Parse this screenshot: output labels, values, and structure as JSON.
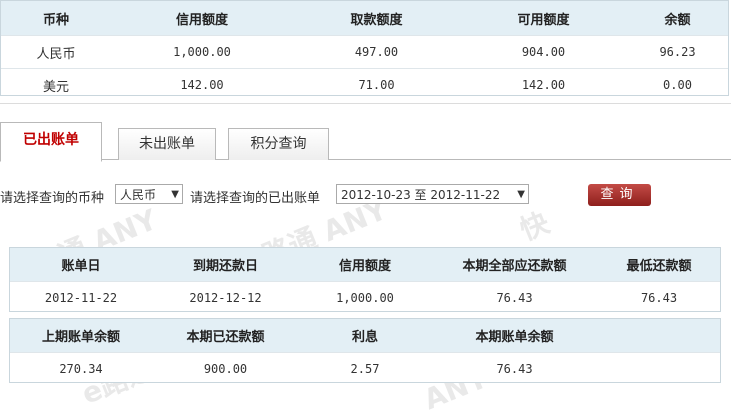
{
  "balances": {
    "headers": [
      "币种",
      "信用额度",
      "取款额度",
      "可用额度",
      "余额"
    ],
    "rows": [
      [
        "人民币",
        "1,000.00",
        "497.00",
        "904.00",
        "96.23"
      ],
      [
        "美元",
        "142.00",
        "71.00",
        "142.00",
        "0.00"
      ]
    ]
  },
  "tabs": [
    "已出账单",
    "未出账单",
    "积分查询"
  ],
  "filter": {
    "currency_label": "请选择查询的币种",
    "currency_value": "人民币",
    "period_label": "请选择查询的已出账单",
    "period_value": "2012-10-23 至 2012-11-22",
    "query_button": "查询"
  },
  "statement": {
    "headers": [
      "账单日",
      "到期还款日",
      "信用额度",
      "本期全部应还款额",
      "最低还款额"
    ],
    "values": [
      "2012-11-22",
      "2012-12-12",
      "1,000.00",
      "76.43",
      "76.43"
    ]
  },
  "summary": {
    "headers": [
      "上期账单余额",
      "本期已还款额",
      "利息",
      "本期账单余额"
    ],
    "values": [
      "270.34",
      "900.00",
      "2.57",
      "76.43"
    ]
  }
}
